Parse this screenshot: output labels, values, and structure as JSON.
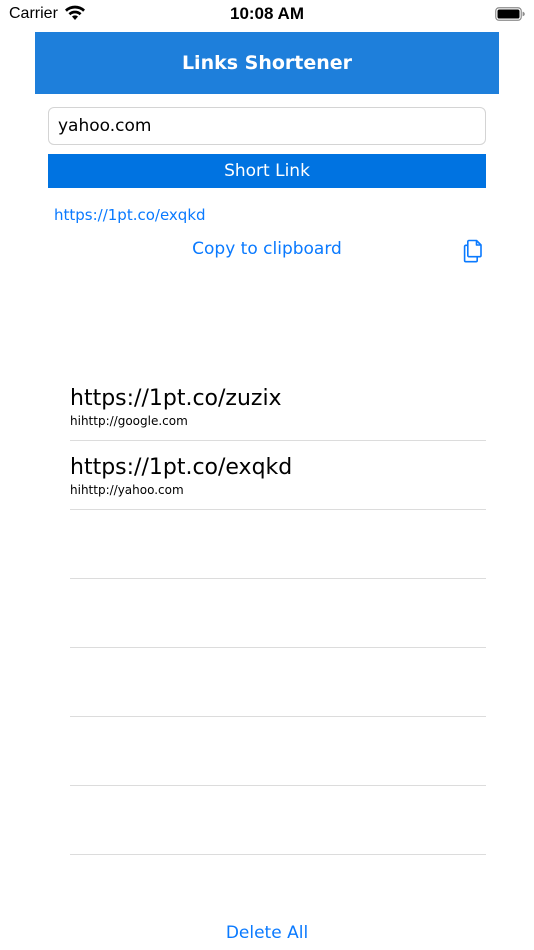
{
  "status_bar": {
    "carrier": "Carrier",
    "time": "10:08 AM",
    "wifi_icon": "wifi-icon",
    "battery_icon": "battery-icon"
  },
  "header": {
    "title": "Links Shortener",
    "color": "#1e7fdb"
  },
  "form": {
    "url_value": "yahoo.com",
    "short_button_label": "Short Link",
    "button_color": "#0073e1"
  },
  "result": {
    "short_link": "https://1pt.co/exqkd",
    "copy_label": "Copy to clipboard",
    "copy_icon": "copy-documents-icon",
    "link_color": "#0a7aff"
  },
  "history": {
    "items": [
      {
        "short": "https://1pt.co/zuzix",
        "original": "hihttp://google.com"
      },
      {
        "short": "https://1pt.co/exqkd",
        "original": "hihttp://yahoo.com"
      },
      {
        "short": "",
        "original": ""
      },
      {
        "short": "",
        "original": ""
      },
      {
        "short": "",
        "original": ""
      },
      {
        "short": "",
        "original": ""
      },
      {
        "short": "",
        "original": ""
      }
    ]
  },
  "footer": {
    "delete_all_label": "Delete All"
  }
}
